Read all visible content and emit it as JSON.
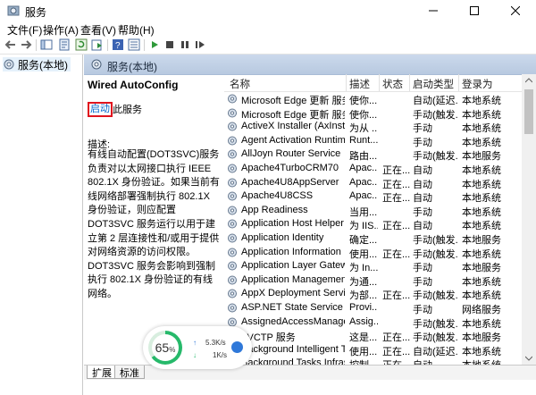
{
  "window": {
    "title": "服务"
  },
  "menu": [
    "文件(F)",
    "操作(A)",
    "查看(V)",
    "帮助(H)"
  ],
  "toolbar": {
    "icons": [
      "back-icon",
      "forward-icon",
      "show-tree-icon",
      "properties-icon",
      "refresh-icon",
      "export-icon",
      "help-icon",
      "view-icon",
      "start-service-icon",
      "stop-service-icon",
      "pause-service-icon",
      "restart-service-icon"
    ]
  },
  "tree": {
    "root_label": "服务(本地)"
  },
  "header": {
    "label": "服务(本地)"
  },
  "detail": {
    "service_name": "Wired AutoConfig",
    "start_link": "启动",
    "start_suffix": "此服务",
    "desc_label": "描述:",
    "desc_text": "有线自动配置(DOT3SVC)服务负责对以太网接口执行 IEEE 802.1X 身份验证。如果当前有线网络部署强制执行 802.1X 身份验证，则应配置 DOT3SVC 服务运行以用于建立第 2 层连接性和/或用于提供对网络资源的访问权限。DOT3SVC 服务会影响到强制执行 802.1X 身份验证的有线网络。"
  },
  "list": {
    "columns": [
      "名称",
      "描述",
      "状态",
      "启动类型",
      "登录为"
    ],
    "rows": [
      {
        "name": "Microsoft Edge 更新 服务 (...",
        "desc": "使你...",
        "status": "",
        "start": "自动(延迟...",
        "logon": "本地系统"
      },
      {
        "name": "Microsoft Edge 更新 服务 (...",
        "desc": "使你...",
        "status": "",
        "start": "手动(触发...",
        "logon": "本地系统"
      },
      {
        "name": "ActiveX Installer (AxInstSV)",
        "desc": "为从 ...",
        "status": "",
        "start": "手动",
        "logon": "本地系统"
      },
      {
        "name": "Agent Activation Runtime_...",
        "desc": "Runt...",
        "status": "",
        "start": "手动",
        "logon": "本地系统"
      },
      {
        "name": "AllJoyn Router Service",
        "desc": "路由...",
        "status": "",
        "start": "手动(触发...",
        "logon": "本地服务"
      },
      {
        "name": "Apache4TurboCRM70",
        "desc": "Apac...",
        "status": "正在...",
        "start": "自动",
        "logon": "本地系统"
      },
      {
        "name": "Apache4U8AppServer",
        "desc": "Apac...",
        "status": "正在...",
        "start": "自动",
        "logon": "本地系统"
      },
      {
        "name": "Apache4U8CSS",
        "desc": "Apac...",
        "status": "正在...",
        "start": "自动",
        "logon": "本地系统"
      },
      {
        "name": "App Readiness",
        "desc": "当用...",
        "status": "",
        "start": "手动",
        "logon": "本地系统"
      },
      {
        "name": "Application Host Helper Se...",
        "desc": "为 IIS...",
        "status": "正在...",
        "start": "自动",
        "logon": "本地系统"
      },
      {
        "name": "Application Identity",
        "desc": "确定...",
        "status": "",
        "start": "手动(触发...",
        "logon": "本地服务"
      },
      {
        "name": "Application Information",
        "desc": "使用...",
        "status": "正在...",
        "start": "手动(触发...",
        "logon": "本地系统"
      },
      {
        "name": "Application Layer Gateway ...",
        "desc": "为 In...",
        "status": "",
        "start": "手动",
        "logon": "本地服务"
      },
      {
        "name": "Application Management",
        "desc": "为通...",
        "status": "",
        "start": "手动",
        "logon": "本地系统"
      },
      {
        "name": "AppX Deployment Service ...",
        "desc": "为部...",
        "status": "正在...",
        "start": "手动(触发...",
        "logon": "本地系统"
      },
      {
        "name": "ASP.NET State Service",
        "desc": "Provi...",
        "status": "",
        "start": "手动",
        "logon": "网络服务"
      },
      {
        "name": "AssignedAccessManager ...",
        "desc": "Assig...",
        "status": "",
        "start": "手动(触发...",
        "logon": "本地系统"
      },
      {
        "name": "AVCTP 服务",
        "desc": "这是...",
        "status": "正在...",
        "start": "手动(触发...",
        "logon": "本地服务"
      },
      {
        "name": "Background Intelligent Tra...",
        "desc": "使用...",
        "status": "正在...",
        "start": "自动(延迟...",
        "logon": "本地系统"
      },
      {
        "name": "Background Tasks Infrastru...",
        "desc": "控制...",
        "status": "正在...",
        "start": "自动",
        "logon": "本地系统"
      }
    ]
  },
  "tabs": [
    "扩展",
    "标准"
  ],
  "net_widget": {
    "percent": "65",
    "percent_unit": "%",
    "percent_value": 65,
    "up": "5.3K/s",
    "down": "1K/s"
  }
}
